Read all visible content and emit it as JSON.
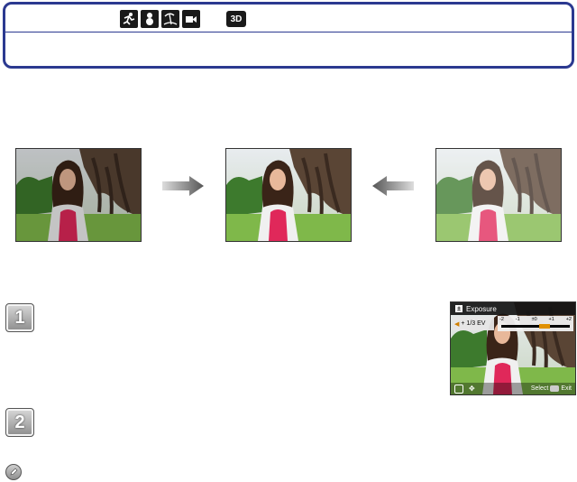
{
  "mode_bar": {
    "icons": [
      "sports-mode-icon",
      "snow-mode-icon",
      "beach-mode-icon",
      "video-mode-icon"
    ],
    "badge_3d": "3D"
  },
  "lcd": {
    "title": "Exposure",
    "ev_value": "+ 1/3 EV",
    "scale_ticks": [
      "-2",
      "-1",
      "±0",
      "+1",
      "+2"
    ],
    "bottom_text": "Select",
    "exit_label": "Exit"
  },
  "steps": [
    {
      "number": "1"
    },
    {
      "number": "2"
    }
  ],
  "colors": {
    "frame_blue": "#2b3990",
    "lcd_accent": "#e09000"
  }
}
